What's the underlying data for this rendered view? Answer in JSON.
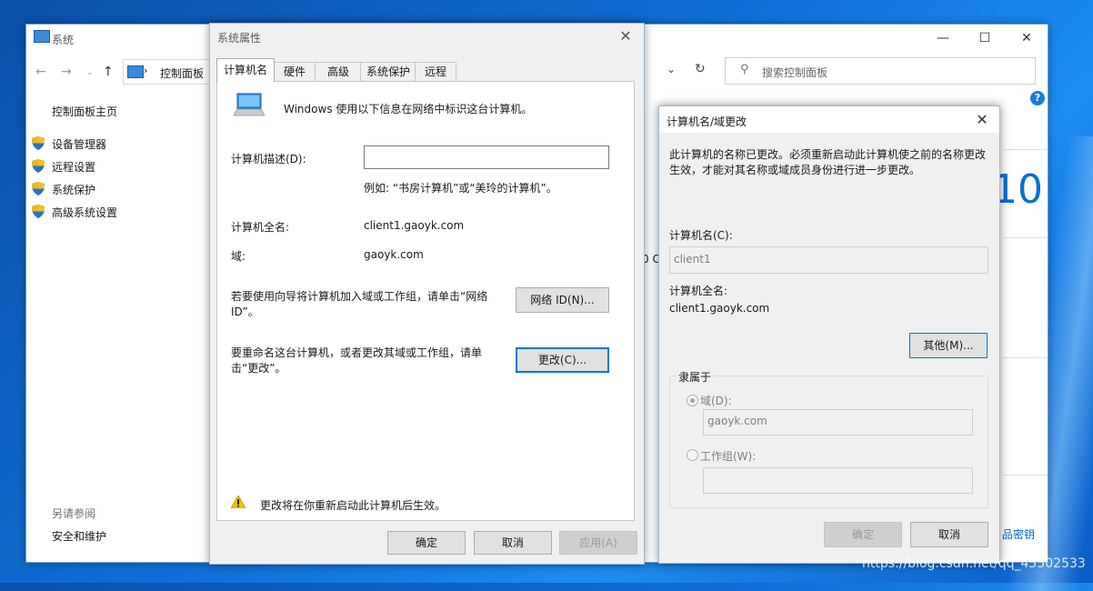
{
  "background_window": {
    "title": "系统",
    "breadcrumb": "控制面板",
    "search_placeholder": "搜索控制面板",
    "sidebar_home": "控制面板主页",
    "sidebar_items": [
      "设备管理器",
      "远程设置",
      "系统保护",
      "高级系统设置"
    ],
    "see_also": "另请参阅",
    "see_also_item": "安全和维护",
    "partial_text_right": "10",
    "partial_text_mid": "0 C",
    "partial_text_bottom": "品密钥"
  },
  "system_properties": {
    "title": "系统属性",
    "tabs": [
      "计算机名",
      "硬件",
      "高级",
      "系统保护",
      "远程"
    ],
    "intro": "Windows 使用以下信息在网络中标识这台计算机。",
    "description_label": "计算机描述(D):",
    "description_value": "",
    "example": "例如: “书房计算机”或“美玲的计算机”。",
    "full_name_label": "计算机全名:",
    "full_name_value": "client1.gaoyk.com",
    "domain_label": "域:",
    "domain_value": "gaoyk.com",
    "network_id_text": "若要使用向导将计算机加入域或工作组，请单击“网络 ID”。",
    "network_id_button": "网络 ID(N)...",
    "rename_text": "要重命名这台计算机，或者更改其域或工作组，请单击“更改”。",
    "change_button": "更改(C)...",
    "warning_text": "更改将在你重新启动此计算机后生效。",
    "ok_button": "确定",
    "cancel_button": "取消",
    "apply_button": "应用(A)"
  },
  "computer_name_dialog": {
    "title": "计算机名/域更改",
    "notice": "此计算机的名称已更改。必须重新启动此计算机使之前的名称更改生效，才能对其名称或域成员身份进行进一步更改。",
    "name_label": "计算机名(C):",
    "name_value": "client1",
    "full_name_label": "计算机全名:",
    "full_name_value": "client1.gaoyk.com",
    "more_button": "其他(M)...",
    "member_of_label": "隶属于",
    "domain_radio_label": "域(D):",
    "domain_value": "gaoyk.com",
    "workgroup_radio_label": "工作组(W):",
    "workgroup_value": "",
    "ok_button": "确定",
    "cancel_button": "取消"
  },
  "watermark": "https://blog.csdn.net/qq_45502533",
  "colors": {
    "accent": "#0078d7",
    "desktop": "#0f6fd6",
    "dialog_bg": "#f0f0f0"
  }
}
